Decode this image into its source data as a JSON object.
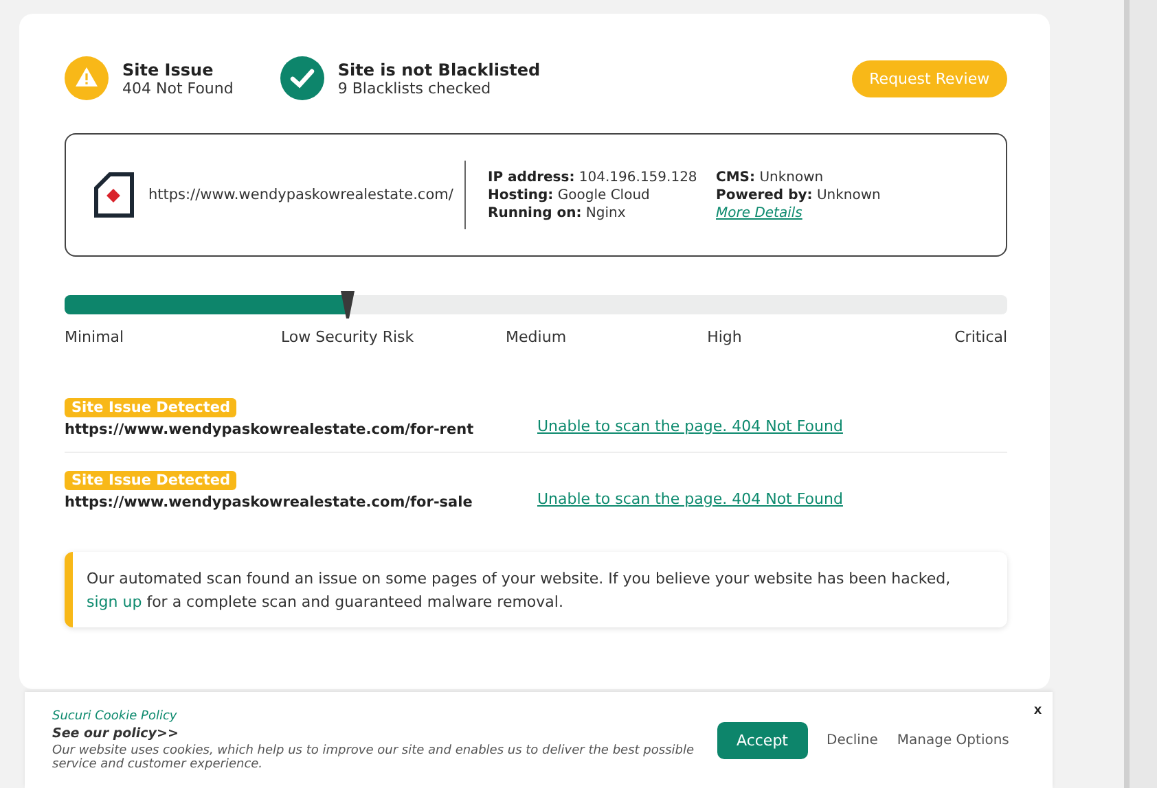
{
  "status": [
    {
      "kind": "warning",
      "title": "Site Issue",
      "subtitle": "404 Not Found"
    },
    {
      "kind": "ok",
      "title": "Site is not Blacklisted",
      "subtitle": "9 Blacklists checked"
    }
  ],
  "request_button": "Request Review",
  "site_info": {
    "url": "https://www.wendypaskowrealestate.com/",
    "details": [
      [
        {
          "label": "IP address:",
          "value": "104.196.159.128"
        },
        {
          "label": "Hosting:",
          "value": "Google Cloud"
        },
        {
          "label": "Running on:",
          "value": "Nginx"
        }
      ],
      [
        {
          "label": "CMS:",
          "value": "Unknown"
        },
        {
          "label": "Powered by:",
          "value": "Unknown"
        }
      ]
    ],
    "more_link": "More Details"
  },
  "risk": {
    "level": 0.3,
    "labels": [
      "Minimal",
      "Low Security Risk",
      "Medium",
      "High",
      "Critical"
    ]
  },
  "issues": [
    {
      "badge": "Site Issue Detected",
      "url": "https://www.wendypaskowrealestate.com/for-rent",
      "message": "Unable to scan the page. 404 Not Found"
    },
    {
      "badge": "Site Issue Detected",
      "url": "https://www.wendypaskowrealestate.com/for-sale",
      "message": "Unable to scan the page. 404 Not Found"
    }
  ],
  "notice": {
    "before": "Our automated scan found an issue on some pages of your website. If you believe your website has been hacked,",
    "link": "sign up",
    "after": "for a complete scan and guaranteed malware removal."
  },
  "cookie": {
    "title": "Sucuri Cookie Policy",
    "policy_link": "See our policy>>",
    "text": "Our website uses cookies, which help us to improve our site and enables us to deliver the best possible service and customer experience.",
    "buttons": [
      "Accept",
      "Decline",
      "Manage Options"
    ],
    "close": "x"
  }
}
